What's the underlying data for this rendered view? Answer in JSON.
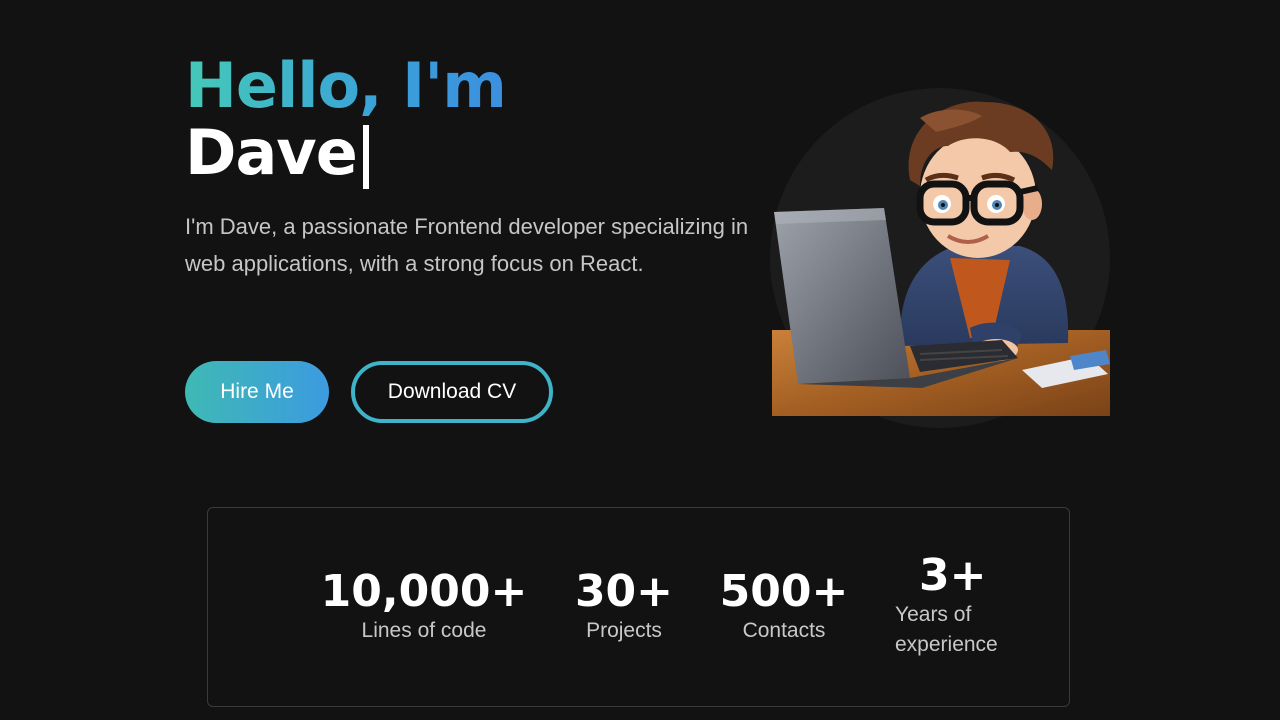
{
  "hero": {
    "greeting": "Hello, I'm",
    "name": "Dave",
    "intro": "I'm Dave, a passionate Frontend developer specializing in web applications, with a strong focus on React."
  },
  "buttons": {
    "hire_label": "Hire Me",
    "cv_label": "Download CV"
  },
  "colors": {
    "background": "#121212",
    "accent_teal": "#45c9b8",
    "accent_blue": "#3b8fe0"
  },
  "stats": [
    {
      "value": "10,000+",
      "label": "Lines of code"
    },
    {
      "value": "30+",
      "label": "Projects"
    },
    {
      "value": "500+",
      "label": "Contacts"
    },
    {
      "value": "3+",
      "label_line1": "Years of",
      "label_line2": "experience"
    }
  ]
}
